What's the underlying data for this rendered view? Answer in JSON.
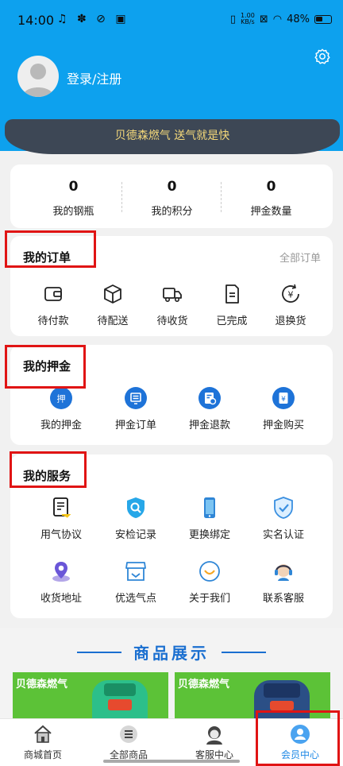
{
  "status_bar": {
    "time": "14:00",
    "left_icons": "♫ ✽ ⊘ ▣",
    "speed_value": "1.00",
    "speed_unit": "KB/s",
    "battery": "48%"
  },
  "profile": {
    "login_label": "登录/注册"
  },
  "banner": {
    "text": "贝德森燃气 送气就是快"
  },
  "stats": [
    {
      "value": "0",
      "label": "我的钢瓶"
    },
    {
      "value": "0",
      "label": "我的积分"
    },
    {
      "value": "0",
      "label": "押金数量"
    }
  ],
  "orders": {
    "title": "我的订单",
    "more": "全部订单",
    "items": [
      {
        "label": "待付款",
        "icon": "wallet-icon"
      },
      {
        "label": "待配送",
        "icon": "package-icon"
      },
      {
        "label": "待收货",
        "icon": "truck-icon"
      },
      {
        "label": "已完成",
        "icon": "document-icon"
      },
      {
        "label": "退换货",
        "icon": "refund-icon"
      }
    ]
  },
  "deposit": {
    "title": "我的押金",
    "items": [
      {
        "label": "我的押金",
        "icon_text": "押"
      },
      {
        "label": "押金订单",
        "icon": "order-list-icon"
      },
      {
        "label": "押金退款",
        "icon": "refund-doc-icon"
      },
      {
        "label": "押金购买",
        "icon": "yen-receipt-icon"
      }
    ]
  },
  "services": {
    "title": "我的服务",
    "items": [
      {
        "label": "用气协议",
        "icon": "agreement-icon"
      },
      {
        "label": "安检记录",
        "icon": "inspection-icon"
      },
      {
        "label": "更换绑定",
        "icon": "phone-icon"
      },
      {
        "label": "实名认证",
        "icon": "shield-check-icon"
      },
      {
        "label": "收货地址",
        "icon": "location-icon"
      },
      {
        "label": "优选气点",
        "icon": "store-icon"
      },
      {
        "label": "关于我们",
        "icon": "smile-icon"
      },
      {
        "label": "联系客服",
        "icon": "headset-icon"
      }
    ]
  },
  "products": {
    "title": "商品展示",
    "cards": [
      {
        "label": "贝德森燃气"
      },
      {
        "label": "贝德森燃气"
      }
    ]
  },
  "tabbar": [
    {
      "label": "商城首页",
      "active": false
    },
    {
      "label": "全部商品",
      "active": false
    },
    {
      "label": "客服中心",
      "active": false
    },
    {
      "label": "会员中心",
      "active": true
    }
  ],
  "colors": {
    "header_blue": "#0da1ee",
    "banner_dark": "#3d4755",
    "banner_text": "#f5d97a",
    "accent_blue": "#1e88e5",
    "highlight_red": "#e01414",
    "product_green": "#5cc237"
  }
}
